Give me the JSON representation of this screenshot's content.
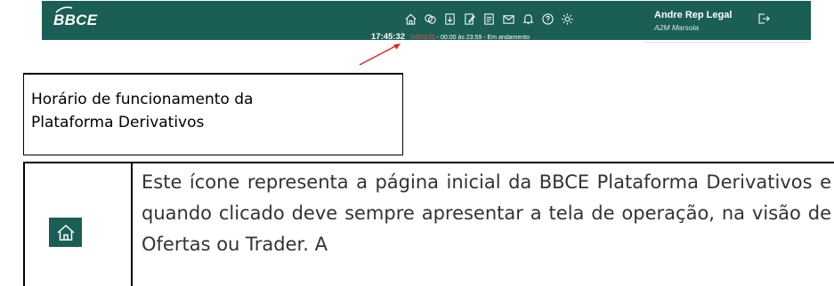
{
  "header": {
    "logo_text": "BBCE",
    "toolbar_icons": [
      "home-icon",
      "transfer-icon",
      "document-download-icon",
      "edit-document-icon",
      "report-icon",
      "mail-icon",
      "bell-icon",
      "help-icon",
      "settings-icon"
    ],
    "status": {
      "time": "17:45:32",
      "date": "04/03/20",
      "separator": " - ",
      "hours": "00:00 às 23:59 - Em andamento"
    },
    "user": {
      "name": "Andre Rep Legal",
      "organization": "A2M Marsola"
    }
  },
  "callout": {
    "label_line1": "Horário de funcionamento da",
    "label_line2": "Plataforma Derivativos"
  },
  "description": {
    "text": "Este ícone representa a página inicial da BBCE Plataforma Derivativos e quando clicado deve sempre apresentar a tela de operação, na visão de Ofertas ou Trader. A"
  },
  "colors": {
    "header_bg": "#1b5e55",
    "status_date": "#e05252",
    "arrow": "#e02020"
  }
}
